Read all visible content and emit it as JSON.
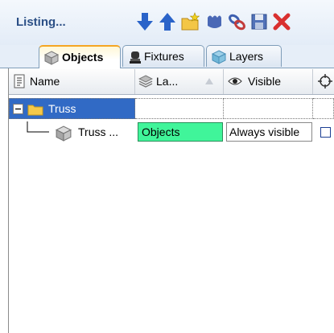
{
  "panel": {
    "title": "Listing..."
  },
  "toolbar": {
    "icons": [
      "arrow-down-icon",
      "arrow-up-icon",
      "new-folder-icon",
      "stamp-icon",
      "link-icon",
      "save-icon",
      "close-icon"
    ]
  },
  "tabs": [
    {
      "label": "Objects",
      "icon": "cube-icon",
      "active": true
    },
    {
      "label": "Fixtures",
      "icon": "fixture-icon",
      "active": false
    },
    {
      "label": "Layers",
      "icon": "layers-icon",
      "active": false
    }
  ],
  "columns": {
    "name": "Name",
    "layer": "La...",
    "visible": "Visible"
  },
  "rows": [
    {
      "name": "Truss",
      "type": "group",
      "expanded": false,
      "selected": true
    },
    {
      "name": "Truss ...",
      "layer": "Objects",
      "visibility": "Always visible"
    }
  ],
  "colors": {
    "selection": "#316ac5",
    "layer_highlight": "#40f59a",
    "header_title": "#2b4f86",
    "active_tab_accent": "#f5a623"
  }
}
